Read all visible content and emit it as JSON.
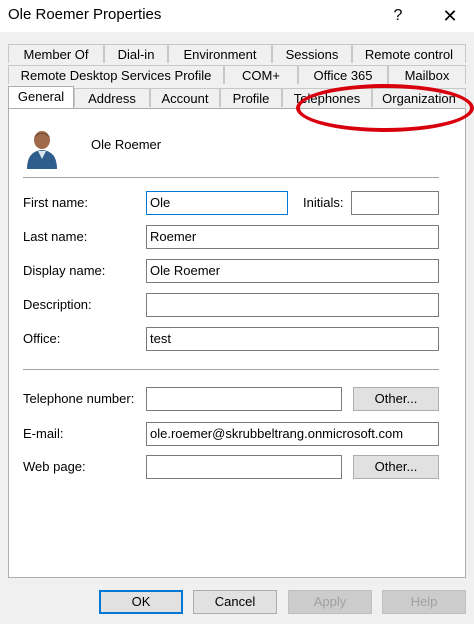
{
  "window": {
    "title": "Ole Roemer Properties",
    "help_label": "?",
    "close_label": "✕"
  },
  "tabs": {
    "row1": [
      "Member Of",
      "Dial-in",
      "Environment",
      "Sessions",
      "Remote control"
    ],
    "row2": [
      "Remote Desktop Services Profile",
      "COM+",
      "Office 365",
      "Mailbox"
    ],
    "row3": [
      "General",
      "Address",
      "Account",
      "Profile",
      "Telephones",
      "Organization"
    ],
    "active": "General"
  },
  "user": {
    "display": "Ole Roemer"
  },
  "fields": {
    "first_name": {
      "label": "First name:",
      "value": "Ole"
    },
    "initials": {
      "label": "Initials:",
      "value": ""
    },
    "last_name": {
      "label": "Last name:",
      "value": "Roemer"
    },
    "display_name": {
      "label": "Display name:",
      "value": "Ole Roemer"
    },
    "description": {
      "label": "Description:",
      "value": ""
    },
    "office": {
      "label": "Office:",
      "value": "test"
    },
    "telephone": {
      "label": "Telephone number:",
      "value": ""
    },
    "email": {
      "label": "E-mail:",
      "value": "ole.roemer@skrubbeltrang.onmicrosoft.com"
    },
    "web_page": {
      "label": "Web page:",
      "value": ""
    }
  },
  "other_buttons": {
    "telephone": "Other...",
    "web_page": "Other..."
  },
  "buttons": {
    "ok": "OK",
    "cancel": "Cancel",
    "apply": "Apply",
    "help": "Help"
  },
  "highlight": {
    "color": "#d9000d"
  }
}
